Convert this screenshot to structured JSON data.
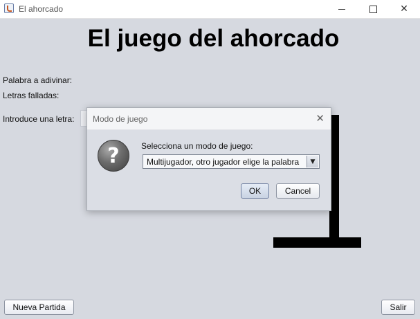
{
  "window": {
    "title": "El ahorcado",
    "icons": {
      "app": "java-cup-icon",
      "minimize": "minimize-icon",
      "maximize": "maximize-icon",
      "close": "close-icon"
    }
  },
  "main": {
    "heading": "El juego del ahorcado",
    "word_label": "Palabra a adivinar:",
    "failed_label": "Letras falladas:",
    "enter_letter_label": "Introduce una letra:",
    "new_game_button": "Nueva Partida",
    "exit_button": "Salir"
  },
  "dialog": {
    "title": "Modo de juego",
    "message": "Selecciona un modo de juego:",
    "selected_mode": "Multijugador, otro jugador elige la palabra",
    "ok_button": "OK",
    "cancel_button": "Cancel",
    "close_glyph": "✕",
    "icon_glyph": "?",
    "dropdown_glyph": "▼"
  },
  "colors": {
    "background": "#d6d9e0",
    "gallows": "#000000",
    "dialog_background": "#dbdee5"
  }
}
